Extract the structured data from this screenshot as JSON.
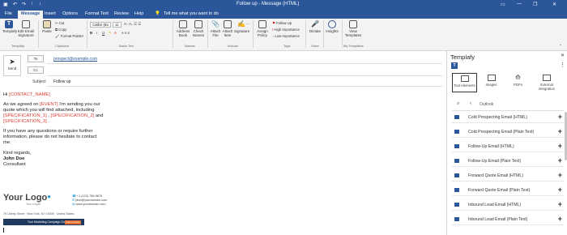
{
  "titlebar": {
    "title": "Follow up - Message (HTML)",
    "save_icon": "save-icon",
    "undo_icon": "undo-icon",
    "redo_icon": "redo-icon",
    "minimize": "—",
    "restore": "❐",
    "close": "✕"
  },
  "tabs": [
    "File",
    "Message",
    "Insert",
    "Options",
    "Format Text",
    "Review",
    "Help"
  ],
  "tell_me": "Tell me what you want to do",
  "ribbon": {
    "templafy": {
      "btn1": "Templafy",
      "btn2": "Edit Email Signature",
      "group": "Templafy"
    },
    "clipboard": {
      "paste": "Paste",
      "cut": "Cut",
      "copy": "Copy",
      "format_painter": "Format Painter",
      "group": "Clipboard"
    },
    "basic_text": {
      "font": "Calibri (Bo",
      "size": "11",
      "bold": "B",
      "italic": "I",
      "underline": "U",
      "group": "Basic Text"
    },
    "names": {
      "address_book": "Address Book",
      "check_names": "Check Names",
      "group": "Names"
    },
    "include": {
      "attach_file": "Attach File",
      "attach_item": "Attach Item",
      "signature": "Signature",
      "group": "Include"
    },
    "tags": {
      "assign_policy": "Assign Policy",
      "follow_up": "Follow Up",
      "high_importance": "High Importance",
      "low_importance": "Low Importance",
      "group": "Tags"
    },
    "voice": {
      "dictate": "Dictate",
      "group": "Voice"
    },
    "insights": {
      "label": "Insights"
    },
    "my_templates": {
      "view_templates": "View Templates",
      "group": "My Templates"
    }
  },
  "compose": {
    "send_label": "Send",
    "to_label": "To",
    "cc_label": "Cc",
    "to_value": "prospect@example.com",
    "subject_label": "Subject",
    "subject_value": "Follow up",
    "greeting": "Hi ",
    "contact_name": "[CONTACT_NAME]",
    "line1a": "As we agreed on ",
    "event": "[EVENT]",
    "line1b": " I'm sending you our",
    "line2": "quote which you will find attached, including",
    "spec1": "[SPECIFICATION_1]",
    "spec_sep": " , ",
    "spec2": "[SPECIFICATION_2]",
    "and": " and",
    "spec3": "[SPECIFICATION_3]",
    "spec_end": " .",
    "line4": "If you have any questions or require further",
    "line5": "information, please do not hesitate to contact",
    "line6": "me.",
    "regards": "Kind regards,",
    "sig_name": "John Doe",
    "sig_title": "Consultant",
    "logo_text": "Your Logo",
    "logo_tagline": "Your slogan",
    "phone": "+1 (123) 756-9876",
    "email_sig": "jdoe@yourdomain.com",
    "web": "www.yourdomain.com",
    "address": "79 Liberty Street · New York, NY 10005 · United States",
    "banner_text": "Your Marketing Campaign Goes Here",
    "banner_button": "Call-to-Action"
  },
  "pane": {
    "title": "Templafy",
    "close": "✕",
    "more": "⋮",
    "tabs": [
      {
        "label": "Text elements",
        "icon": "text-elements-icon"
      },
      {
        "label": "Images",
        "icon": "images-icon"
      },
      {
        "label": "PDFs",
        "icon": "pdf-icon"
      },
      {
        "label": "External integration",
        "icon": "external-integration-icon"
      }
    ],
    "breadcrumb": "Outlook",
    "items": [
      "Cold Prospecting Email (HTML)",
      "Cold Prospecting Email (Plain Text)",
      "Follow-Up Email (HTML)",
      "Follow-Up Email (Plain Text)",
      "Forward Quote Email (HTML)",
      "Forward Quote Email (Plain Text)",
      "Inbound Lead Email (HTML)",
      "Inbound Lead Email (Plain Text)"
    ]
  },
  "colors": {
    "brand": "#2b579a",
    "placeholder_red": "#e03c31",
    "banner": "#1f3a5f",
    "banner_btn": "#e26b2d"
  }
}
